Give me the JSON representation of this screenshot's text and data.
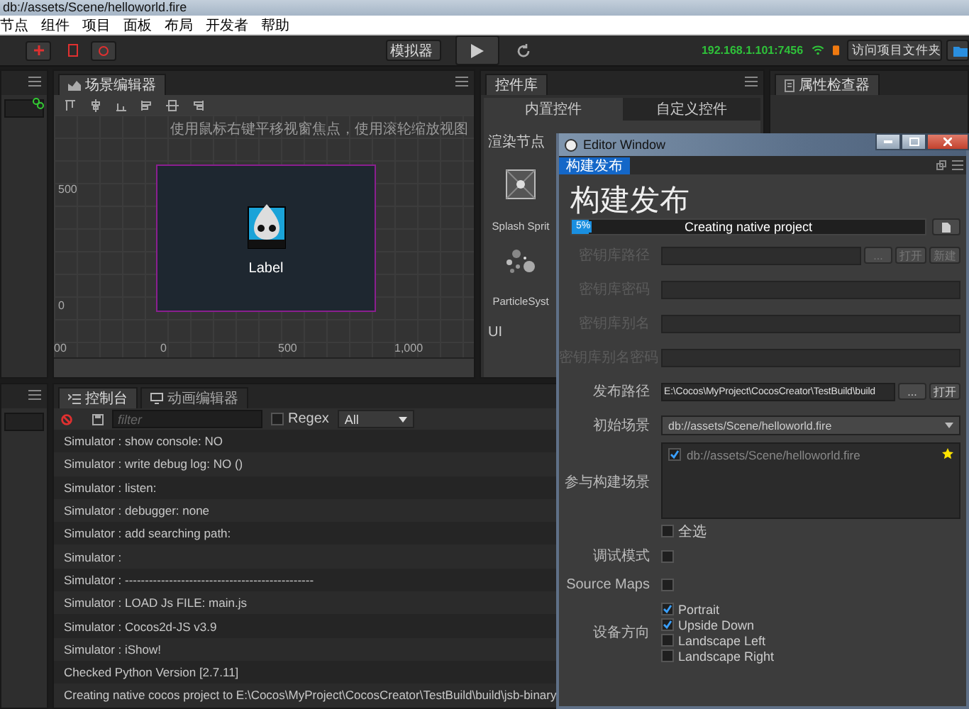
{
  "window": {
    "title": "db://assets/Scene/helloworld.fire"
  },
  "menu": [
    "节点",
    "组件",
    "项目",
    "面板",
    "布局",
    "开发者",
    "帮助"
  ],
  "toolbar": {
    "platform": "模拟器",
    "ip": "192.168.1.101:7456",
    "open_project_button": "访问项目文件夹"
  },
  "scene_editor": {
    "tab": "场景编辑器",
    "hint": "使用鼠标右键平移视窗焦点，使用滚轮缩放视图",
    "y_ticks": [
      "500",
      "0"
    ],
    "x_ticks": [
      "00",
      "0",
      "500",
      "1,000"
    ],
    "node_label": "Label"
  },
  "widget_library": {
    "tab": "控件库",
    "tabs": [
      {
        "label": "内置控件",
        "selected": true
      },
      {
        "label": "自定义控件",
        "selected": false
      }
    ],
    "section": "渲染节点",
    "items": [
      {
        "kind": "sprite",
        "label": "Splash Sprit"
      },
      {
        "kind": "particle",
        "label": "ParticleSyst"
      }
    ],
    "next_section": "UI"
  },
  "inspector": {
    "tab": "属性检查器"
  },
  "console": {
    "tabs": [
      {
        "label": "控制台",
        "selected": true
      },
      {
        "label": "动画编辑器",
        "selected": false
      }
    ],
    "filter_placeholder": "filter",
    "regex": {
      "label": "Regex",
      "checked": false
    },
    "level": "All",
    "lines": [
      "Simulator : show console: NO",
      "Simulator : write debug log: NO ()",
      "Simulator : listen:",
      "Simulator : debugger: none",
      "Simulator : add searching path:",
      "Simulator :",
      "Simulator : -----------------------------------------------",
      "Simulator : LOAD Js FILE: main.js",
      "Simulator : Cocos2d-JS v3.9",
      "Simulator : iShow!",
      "Checked Python Version [2.7.11]",
      "Creating native cocos project to E:\\Cocos\\MyProject\\CocosCreator\\TestBuild\\build\\jsb-binary"
    ]
  },
  "build_window": {
    "title": "Editor Window",
    "tab": "构建发布",
    "heading": "构建发布",
    "progress": {
      "level": 0.05,
      "reading": "5%",
      "status": "Creating native project"
    },
    "fields": [
      {
        "kind": "text",
        "label": "密钥库路径",
        "disabled": true,
        "buttons": [
          "...",
          "打开",
          "新建"
        ]
      },
      {
        "kind": "text",
        "label": "密钥库密码",
        "disabled": true
      },
      {
        "kind": "text",
        "label": "密钥库别名",
        "disabled": true
      },
      {
        "kind": "text",
        "label": "密钥库别名密码",
        "disabled": true
      },
      {
        "kind": "text",
        "label": "发布路径",
        "disabled": false,
        "value": "E:\\Cocos\\MyProject\\CocosCreator\\TestBuild\\build",
        "buttons": [
          "...",
          "打开"
        ]
      },
      {
        "kind": "select",
        "label": "初始场景",
        "value": "db://assets/Scene/helloworld.fire"
      },
      {
        "kind": "scenes",
        "label": "参与构建场景",
        "scenes": [
          {
            "path": "db://assets/Scene/helloworld.fire",
            "checked": true
          }
        ],
        "select_all": {
          "label": "全选",
          "checked": false
        }
      },
      {
        "kind": "checkbox",
        "label": "调试模式",
        "checked": false
      },
      {
        "kind": "checkbox",
        "label": "Source Maps",
        "checked": false
      },
      {
        "kind": "options",
        "label": "设备方向",
        "options": [
          {
            "label": "Portrait",
            "checked": true
          },
          {
            "label": "Upside Down",
            "checked": true
          },
          {
            "label": "Landscape Left",
            "checked": false
          },
          {
            "label": "Landscape Right",
            "checked": false
          }
        ]
      }
    ]
  }
}
